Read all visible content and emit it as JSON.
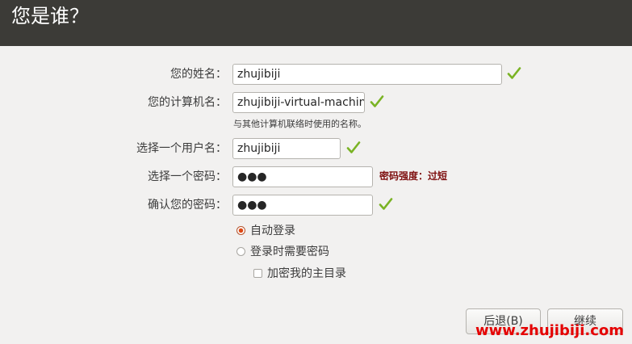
{
  "header": {
    "title": "您是谁？"
  },
  "form": {
    "name_label": "您的姓名：",
    "name_value": "zhujibiji",
    "computer_label": "您的计算机名：",
    "computer_value": "zhujibiji-virtual-machine",
    "computer_hint": "与其他计算机联络时使用的名称。",
    "username_label": "选择一个用户名：",
    "username_value": "zhujibiji",
    "password_label": "选择一个密码：",
    "password_value": "●●●",
    "password_strength": "密码强度：过短",
    "confirm_label": "确认您的密码：",
    "confirm_value": "●●●"
  },
  "login_options": {
    "auto_login": "自动登录",
    "require_password": "登录时需要密码",
    "encrypt_home": "加密我的主目录",
    "selected": "auto_login",
    "encrypt_home_checked": false
  },
  "buttons": {
    "back": "后退(B)",
    "continue": "继续"
  },
  "watermark": "www.zhujibiji.com",
  "colors": {
    "header_bg": "#3c3b37",
    "window_bg": "#f2f1f0",
    "valid_check": "#7ab324",
    "strength_text": "#7e0f0f",
    "radio_selected": "#dd4814",
    "watermark": "#e50000"
  },
  "icons": {
    "valid": "check-mark-icon"
  }
}
